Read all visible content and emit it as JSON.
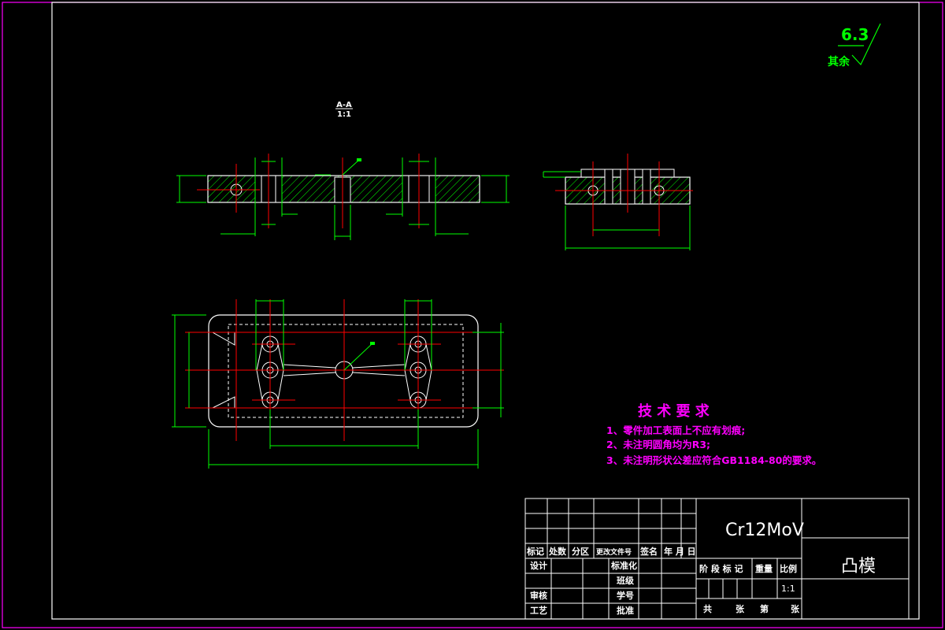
{
  "roughness": {
    "value": "6.3",
    "label": "其余"
  },
  "section_view": {
    "name": "A-A",
    "scale": "1:1"
  },
  "tech_requirements": {
    "title": "技 术 要 求",
    "items": [
      "1、零件加工表面上不应有划痕;",
      "2、未注明圆角均为R3;",
      "3、未注明形状公差应符合GB1184-80的要求。"
    ]
  },
  "title_block": {
    "material": "Cr12MoV",
    "part_name": "凸模",
    "revision_header": [
      "标记",
      "处数",
      "分区",
      "更改文件号",
      "签名",
      "年 月 日"
    ],
    "labels": {
      "design": "设计",
      "standardization": "标准化",
      "class": "班级",
      "review": "审核",
      "student_no": "学号",
      "process": "工艺",
      "approve": "批准"
    },
    "stage_header": [
      "阶 段 标 记",
      "重量",
      "比例"
    ],
    "scale": "1:1",
    "sheet_row": [
      "共",
      "张",
      "第",
      "张"
    ]
  },
  "colors": {
    "background": "#000000",
    "border": "#ff00ff",
    "outline": "#ffffff",
    "centerline": "#ff0000",
    "dimension": "#00ff00",
    "text_note": "#ff00ff"
  }
}
